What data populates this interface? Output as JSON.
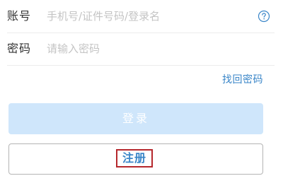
{
  "form": {
    "account": {
      "label": "账号",
      "placeholder": "手机号/证件号码/登录名",
      "help_icon": "question-circle-icon"
    },
    "password": {
      "label": "密码",
      "placeholder": "请输入密码"
    },
    "forgot_password_label": "找回密码",
    "login_label": "登录",
    "register_label": "注册"
  },
  "colors": {
    "link": "#3a86c8",
    "login_button_disabled": "#cfe6fb",
    "highlight_box": "#b5272c"
  }
}
